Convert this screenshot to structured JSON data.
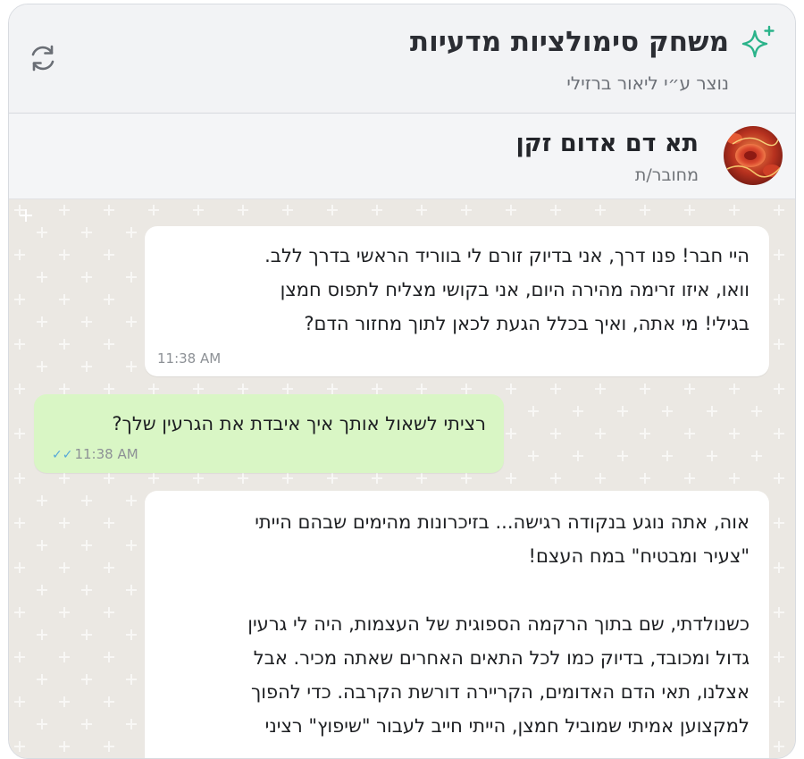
{
  "header": {
    "title": "משחק סימולציות מדעיות",
    "subtitle": "נוצר ע״י ליאור ברזילי",
    "sparkle_icon": "sparkle-icon",
    "refresh_icon": "refresh-icon",
    "accent_color": "#2bb38a"
  },
  "contact": {
    "name": "תא דם אדום זקן",
    "status": "מחובר/ת"
  },
  "messages": [
    {
      "direction": "incoming",
      "lines": [
        "היי חבר! פנו דרך, אני בדיוק זורם לי בווריד הראשי בדרך ללב.",
        "וואו, איזו זרימה מהירה היום, אני בקושי מצליח לתפוס חמצן",
        "בגילי! מי אתה, ואיך בכלל הגעת לכאן לתוך מחזור הדם?"
      ],
      "time": "11:38 AM"
    },
    {
      "direction": "outgoing",
      "lines": [
        "רציתי לשאול אותך איך איבדת את הגרעין שלך?"
      ],
      "time": "11:38 AM"
    },
    {
      "direction": "incoming",
      "lines": [
        "אוה, אתה נוגע בנקודה רגישה... בזיכרונות מהימים שבהם הייתי",
        "\"צעיר ומבטיח\" במח העצם!",
        "",
        "כשנולדתי, שם בתוך הרקמה הספוגית של העצמות, היה לי גרעין",
        "גדול ומכובד, בדיוק כמו לכל התאים האחרים שאתה מכיר. אבל",
        "אצלנו, תאי הדם האדומים, הקריירה דורשת הקרבה. כדי להפוך",
        "למקצוען אמיתי שמוביל חמצן, הייתי חייב לעבור \"שיפוץ\" רציני"
      ]
    }
  ]
}
